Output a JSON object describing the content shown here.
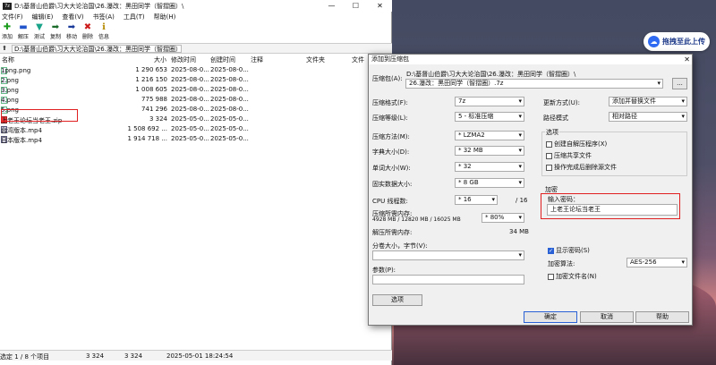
{
  "window": {
    "title": "D:\\基督山伯爵\\习大大论治国\\26.瀑改：黑田同学（智摺圈）\\",
    "buttons": [
      "—",
      "☐",
      "✕"
    ]
  },
  "menu": [
    "文件(F)",
    "编辑(E)",
    "查看(V)",
    "书签(A)",
    "工具(T)",
    "帮助(H)"
  ],
  "toolbar": [
    {
      "label": "添加",
      "icon": "add-icon",
      "glyph": "✚",
      "color": "#1a9a1a"
    },
    {
      "label": "解压",
      "icon": "extract-icon",
      "glyph": "▬",
      "color": "#2255cc"
    },
    {
      "label": "测试",
      "icon": "test-icon",
      "glyph": "▼",
      "color": "#1aa58a"
    },
    {
      "label": "复制",
      "icon": "copy-icon",
      "glyph": "➡",
      "color": "#1b6b2b"
    },
    {
      "label": "移动",
      "icon": "move-icon",
      "glyph": "➡",
      "color": "#1a3a9a"
    },
    {
      "label": "删除",
      "icon": "delete-icon",
      "glyph": "✖",
      "color": "#cc1a1a"
    },
    {
      "label": "信息",
      "icon": "info-icon",
      "glyph": "ℹ",
      "color": "#b58a00"
    }
  ],
  "address": {
    "path": "D:\\基督山伯爵\\习大大论治国\\26.瀑改：黑田同学（智摺圈）\\"
  },
  "columns": [
    "名称",
    "大小",
    "修改时间",
    "创建时间",
    "注释",
    "文件夹",
    "文件"
  ],
  "files": [
    {
      "name": "1png.png",
      "size": "1 290 653",
      "mtime": "2025-08-0...",
      "ctime": "2025-08-0...",
      "type": "img"
    },
    {
      "name": "2.png",
      "size": "1 216 150",
      "mtime": "2025-08-0...",
      "ctime": "2025-08-0...",
      "type": "img"
    },
    {
      "name": "3.png",
      "size": "1 008 605",
      "mtime": "2025-08-0...",
      "ctime": "2025-08-0...",
      "type": "img"
    },
    {
      "name": "4.png",
      "size": "775 988",
      "mtime": "2025-08-0...",
      "ctime": "2025-08-0...",
      "type": "img"
    },
    {
      "name": "5.png",
      "size": "741 296",
      "mtime": "2025-08-0...",
      "ctime": "2025-08-0...",
      "type": "img"
    },
    {
      "name": "上老王论坛当老王.zip",
      "size": "3 324",
      "mtime": "2025-05-0...",
      "ctime": "2025-05-0...",
      "type": "zip"
    },
    {
      "name": "台湾版本.mp4",
      "size": "1 508 692 ...",
      "mtime": "2025-05-0...",
      "ctime": "2025-05-0...",
      "type": "mp4"
    },
    {
      "name": "日本版本.mp4",
      "size": "1 914 718 ...",
      "mtime": "2025-05-0...",
      "ctime": "2025-05-0...",
      "type": "mp4"
    }
  ],
  "status": {
    "selected": "选定 1 / 8 个项目",
    "size1": "3 324",
    "size2": "3 324",
    "date": "2025-05-01 18:24:54"
  },
  "cloud_button": {
    "label": "拖拽至此上传",
    "icon": "cloud-icon"
  },
  "dialog": {
    "title": "添加到压缩包",
    "archive_label": "压缩包(A):",
    "archive_path": "D:\\基督山伯爵\\习大大论治国\\26.瀑改：黑田同学（智摺圈）\\",
    "archive_name": "26.瀑改：黑田同学（智摺圈）.7z",
    "browse": "...",
    "format_label": "压缩格式(F):",
    "format_value": "7z",
    "level_label": "压缩等级(L):",
    "level_value": "5 - 标准压缩",
    "method_label": "压缩方法(M):",
    "method_value": "* LZMA2",
    "dict_label": "字典大小(D):",
    "dict_value": "* 32 MB",
    "word_label": "单词大小(W):",
    "word_value": "* 32",
    "solid_label": "固实数据大小:",
    "solid_value": "* 8 GB",
    "cpu_label": "CPU 线程数:",
    "cpu_value": "* 16",
    "cpu_total": "/ 16",
    "mem_label": "压缩所需内存:",
    "mem_detail": "4928 MB / 12820 MB / 16025 MB",
    "mem_value": "* 80%",
    "unmem_label": "解压所需内存:",
    "unmem_value": "34 MB",
    "split_label": "分卷大小，字节(V):",
    "params_label": "参数(P):",
    "options_button": "选项",
    "update_label": "更新方式(U):",
    "update_value": "添加并替换文件",
    "pathmode_label": "路径模式",
    "pathmode_value": "相对路径",
    "options_group": "选项",
    "opt1": "创建自解压程序(X)",
    "opt2": "压缩共享文件",
    "opt3": "操作完成后删除源文件",
    "encrypt_group": "加密",
    "password_label": "输入密码：",
    "password_value": "上老王论坛当老王",
    "show_password": "显示密码(S)",
    "enc_method_label": "加密算法:",
    "enc_method_value": "AES-256",
    "enc_names": "加密文件名(N)",
    "ok": "确定",
    "cancel": "取消",
    "help": "帮助"
  }
}
